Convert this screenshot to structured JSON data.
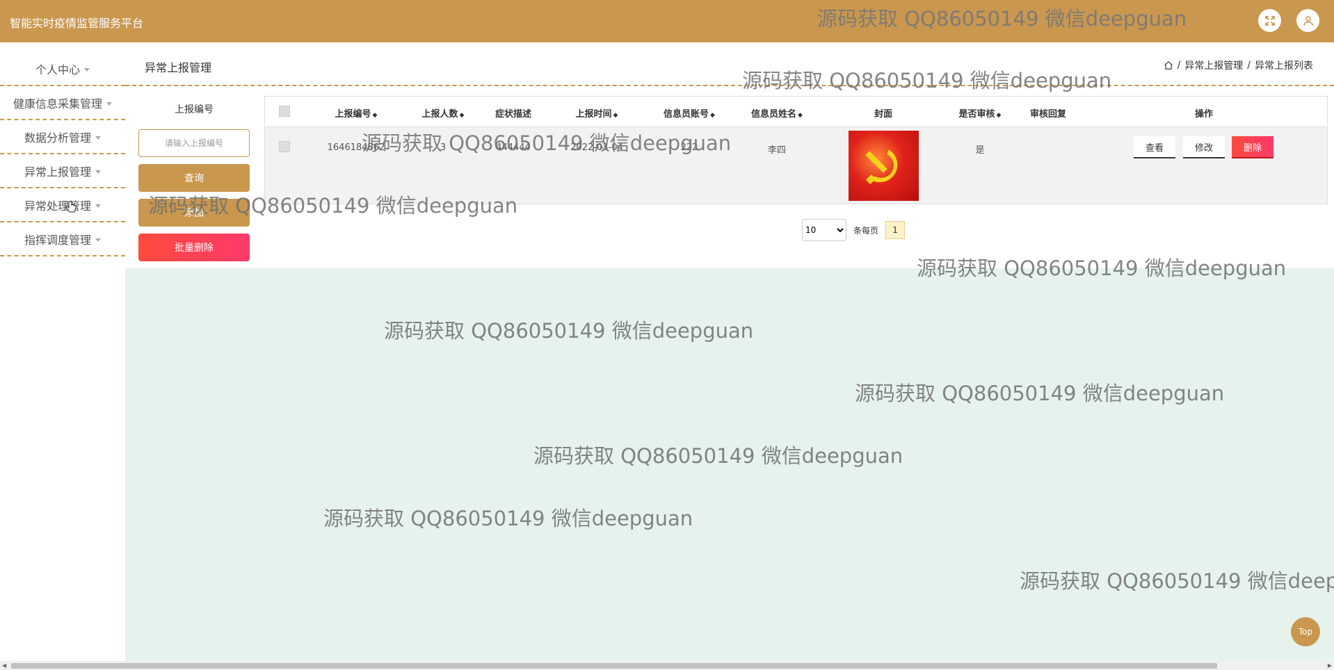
{
  "header": {
    "title": "智能实时疫情监管服务平台",
    "fullscreen_icon": "expand-icon",
    "user_icon": "user-icon"
  },
  "sidebar": {
    "items": [
      {
        "label": "个人中心"
      },
      {
        "label": "健康信息采集管理"
      },
      {
        "label": "数据分析管理"
      },
      {
        "label": "异常上报管理"
      },
      {
        "label": "异常处理管理"
      },
      {
        "label": "指挥调度管理"
      }
    ]
  },
  "page": {
    "title": "异常上报管理",
    "breadcrumb": [
      "异常上报管理",
      "异常上报列表"
    ],
    "breadcrumb_sep": "/"
  },
  "search": {
    "label": "上报编号",
    "placeholder": "请输入上报编号",
    "query_label": "查询",
    "add_label": "添加",
    "batch_delete_label": "批量删除"
  },
  "table": {
    "columns": [
      "上报编号",
      "上报人数",
      "症状描述",
      "上报时间",
      "信息员账号",
      "信息员姓名",
      "封面",
      "是否审核",
      "审核回复",
      "操作"
    ],
    "sort_glyph": "◆",
    "rows": [
      {
        "report_no": "1646184862",
        "count": "3",
        "symptom": "444444",
        "time": "2022-03-04",
        "account": "222",
        "name": "李四",
        "audited": "是",
        "reply": "",
        "view_label": "查看",
        "edit_label": "修改",
        "delete_label": "删除"
      }
    ]
  },
  "pagination": {
    "page_size": "10",
    "per_page_label": "条每页",
    "current_page": "1"
  },
  "watermark": "源码获取 QQ86050149 微信deepguan",
  "top_button": "Top",
  "colors": {
    "brand": "#c9974e",
    "danger": "#ff3a6a",
    "green_bg": "#e6f3ec"
  }
}
